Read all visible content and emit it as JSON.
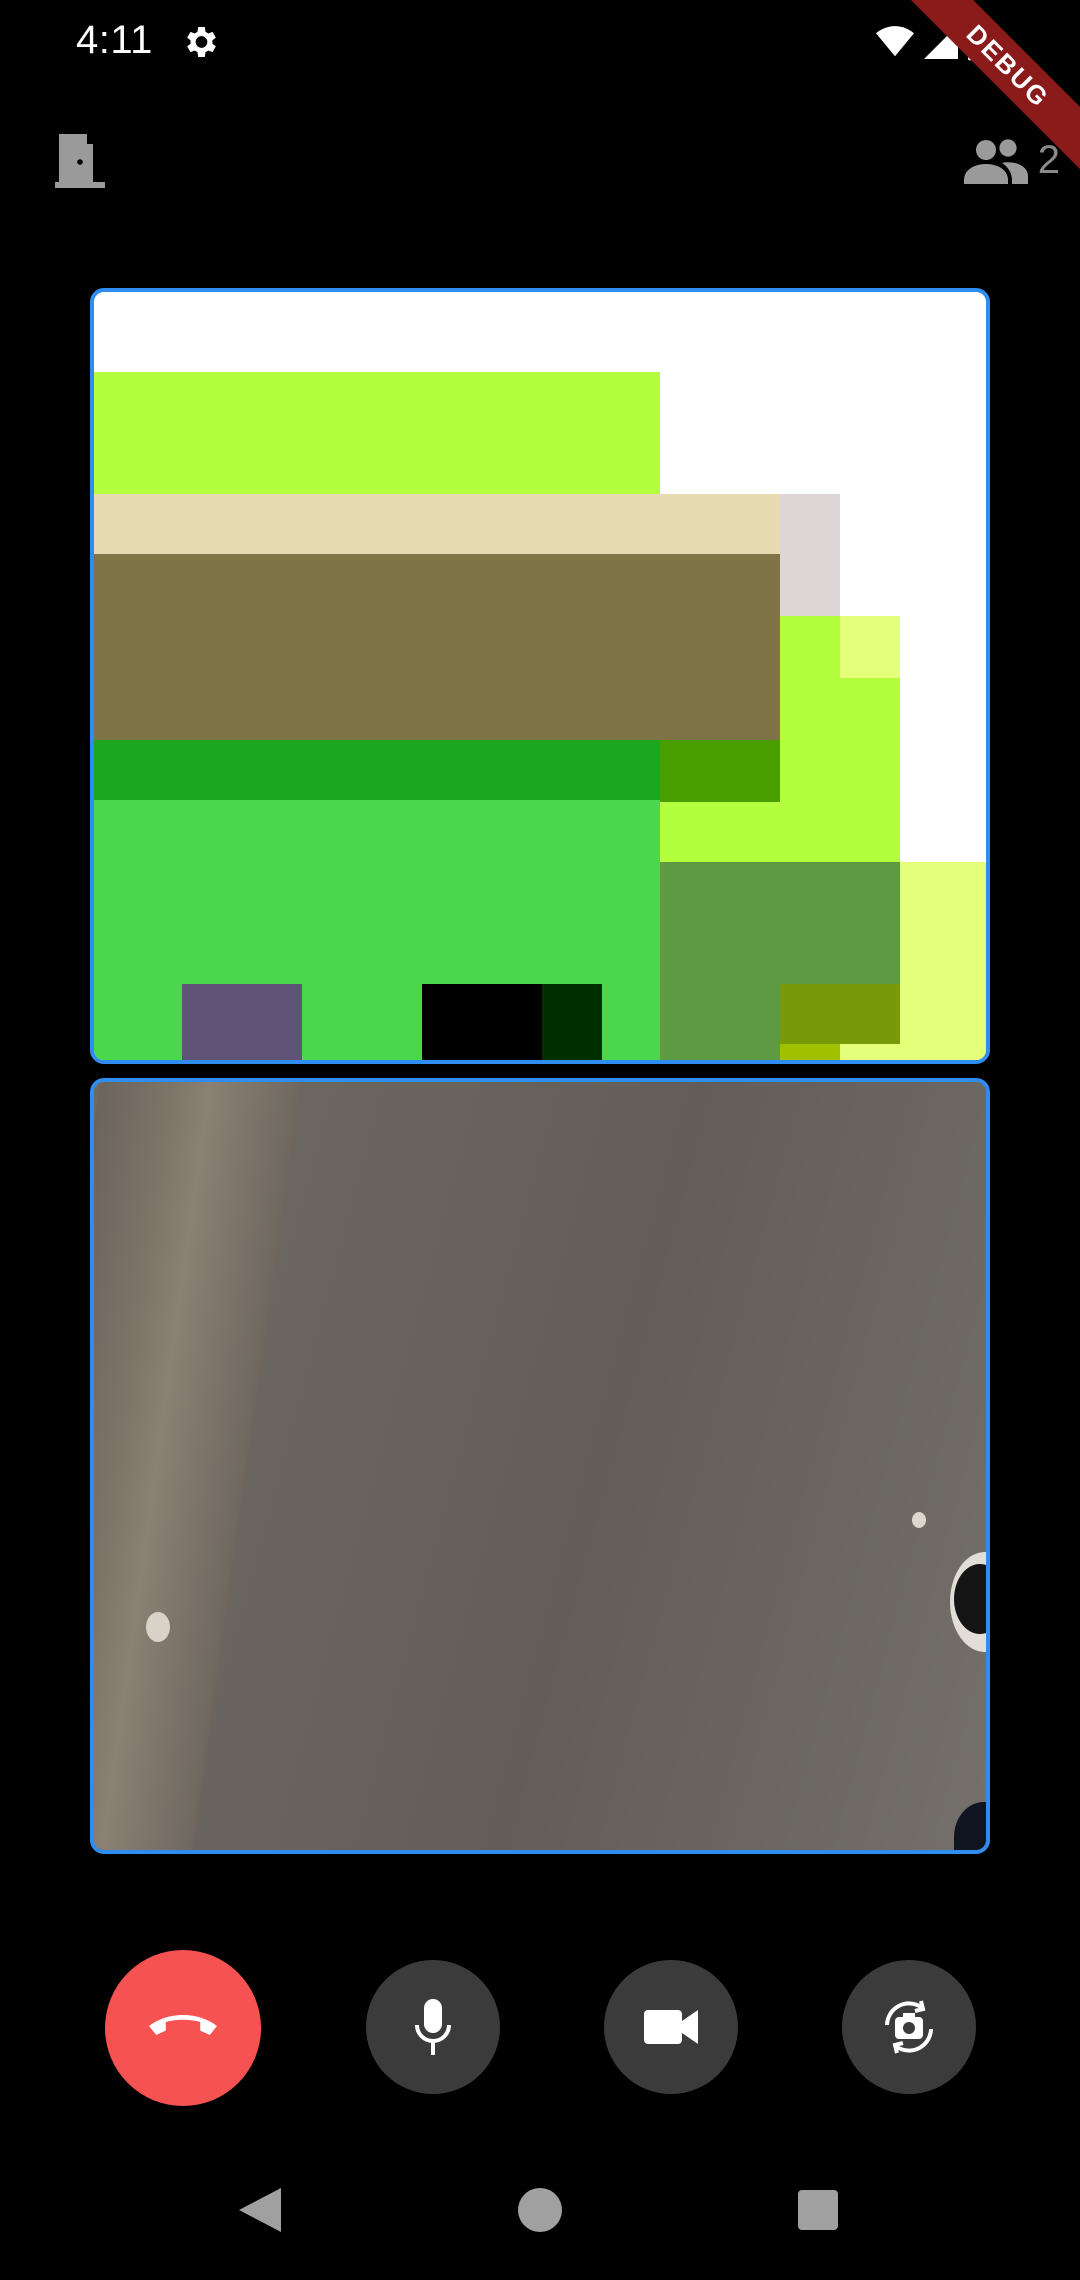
{
  "status_bar": {
    "time": "4:11",
    "debug_banner": "DEBUG",
    "icons": [
      "settings-icon",
      "wifi-icon",
      "cell-signal-icon",
      "battery-icon"
    ]
  },
  "app_bar": {
    "leave_icon": "door-exit-icon",
    "participants_icon": "people-icon",
    "participant_count": "2"
  },
  "tiles": [
    {
      "name": "remote-video-tile",
      "border_color": "#2f8df0"
    },
    {
      "name": "local-video-tile",
      "border_color": "#2f8df0"
    }
  ],
  "controls": {
    "end_call": {
      "icon": "phone-hangup-icon",
      "color": "#f75252"
    },
    "mic": {
      "icon": "microphone-icon",
      "color": "#3b3b3b"
    },
    "camera": {
      "icon": "video-camera-icon",
      "color": "#3b3b3b"
    },
    "switch_camera": {
      "icon": "switch-camera-icon",
      "color": "#3b3b3b"
    }
  },
  "nav_bar": {
    "icons": [
      "back-triangle-icon",
      "home-circle-icon",
      "recents-square-icon"
    ]
  }
}
